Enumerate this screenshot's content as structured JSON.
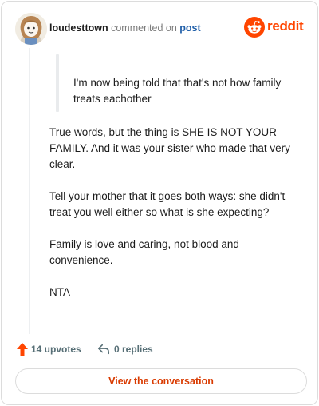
{
  "header": {
    "username": "loudesttown",
    "action_text": "commented on",
    "target_text": "post",
    "avatar_icon": "avatar-icon",
    "brand_icon": "reddit-snoo-icon",
    "brand_text": "reddit"
  },
  "quote": {
    "text": "I'm now being told that that's not how family treats eachother"
  },
  "comment": {
    "paragraphs": [
      "True words, but the thing is SHE IS NOT YOUR FAMILY. And it was your sister who made that very clear.",
      "Tell your mother that it goes both ways: she didn't treat you well either so what is she expecting?",
      "Family is love and caring, not blood and convenience.",
      "NTA"
    ]
  },
  "actions": {
    "upvotes_label": "14 upvotes",
    "upvote_icon": "upvote-arrow-icon",
    "replies_label": "0 replies",
    "reply_icon": "reply-arrow-icon"
  },
  "cta": {
    "label": "View the conversation"
  },
  "colors": {
    "brand": "#ff4500",
    "link": "#1f5ea8",
    "cta_text": "#d93a00",
    "muted": "#576f76"
  }
}
